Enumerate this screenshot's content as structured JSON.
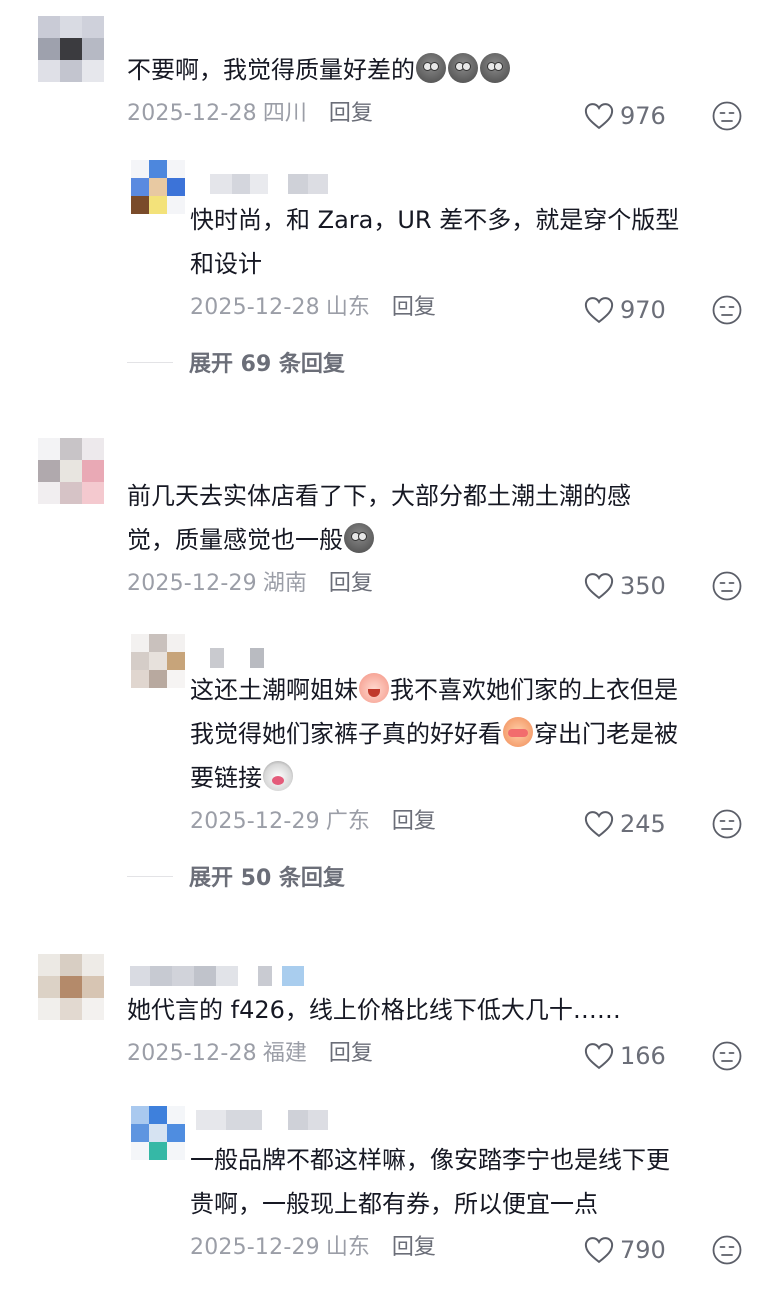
{
  "comments": [
    {
      "text": "不要啊，我觉得质量好差的",
      "emojis": [
        "grey-face-emoji",
        "grey-face-emoji",
        "grey-face-emoji"
      ],
      "date": "2025-12-28",
      "location": "四川",
      "reply_label": "回复",
      "likes": "976",
      "replies": [
        {
          "lines": [
            "快时尚，和 Zara，UR 差不多，就是穿个版型",
            "和设计"
          ],
          "date": "2025-12-28",
          "location": "山东",
          "reply_label": "回复",
          "likes": "970"
        }
      ],
      "expand_label": "展开 69 条回复"
    },
    {
      "lines": [
        "前几天去实体店看了下，大部分都土潮土潮的感",
        "觉，质量感觉也一般"
      ],
      "emojis": [
        "grey-face-emoji"
      ],
      "date": "2025-12-29",
      "location": "湖南",
      "reply_label": "回复",
      "likes": "350",
      "replies": [
        {
          "segments": [
            "这还土潮啊姐妹",
            "我不喜欢她们家的上衣但是",
            "我觉得她们家裤子真的好好看",
            "穿出门老是被",
            "要链接"
          ],
          "emojis": [
            "crying-emoji",
            "shy-emoji",
            "dog-emoji"
          ],
          "date": "2025-12-29",
          "location": "广东",
          "reply_label": "回复",
          "likes": "245"
        }
      ],
      "expand_label": "展开 50 条回复"
    },
    {
      "text": "她代言的 f426，线上价格比线下低大几十……",
      "date": "2025-12-28",
      "location": "福建",
      "reply_label": "回复",
      "likes": "166",
      "replies": [
        {
          "lines": [
            "一般品牌不都这样嘛，像安踏李宁也是线下更",
            "贵啊，一般现上都有券，所以便宜一点"
          ],
          "date": "2025-12-29",
          "location": "山东",
          "reply_label": "回复",
          "likes": "790"
        }
      ]
    }
  ],
  "colors": {
    "text": "#161823",
    "meta": "#9b9ea7",
    "action": "#6b6e78"
  }
}
